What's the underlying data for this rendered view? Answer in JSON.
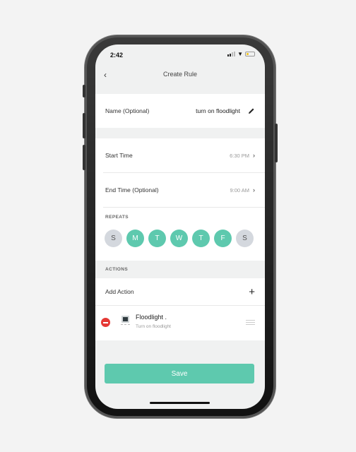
{
  "status_bar": {
    "time": "2:42"
  },
  "nav": {
    "title": "Create Rule",
    "back_icon": "chevron-left"
  },
  "name_row": {
    "label": "Name (Optional)",
    "value": "turn on floodlight",
    "icon": "pencil-icon"
  },
  "start_time": {
    "label": "Start Time",
    "value": "6:30 PM"
  },
  "end_time": {
    "label": "End Time (Optional)",
    "value": "9:00 AM"
  },
  "repeats": {
    "label": "REPEATS",
    "days": [
      {
        "label": "S",
        "selected": false
      },
      {
        "label": "M",
        "selected": true
      },
      {
        "label": "T",
        "selected": true
      },
      {
        "label": "W",
        "selected": true
      },
      {
        "label": "T",
        "selected": true
      },
      {
        "label": "F",
        "selected": true
      },
      {
        "label": "S",
        "selected": false
      }
    ]
  },
  "actions": {
    "label": "ACTIONS",
    "add_label": "Add Action",
    "items": [
      {
        "title": "Floodlight .",
        "subtitle": "Turn on floodlight"
      }
    ]
  },
  "save_label": "Save",
  "colors": {
    "accent": "#5ec9ae",
    "remove": "#e53935",
    "day_off": "#d4d8de"
  }
}
